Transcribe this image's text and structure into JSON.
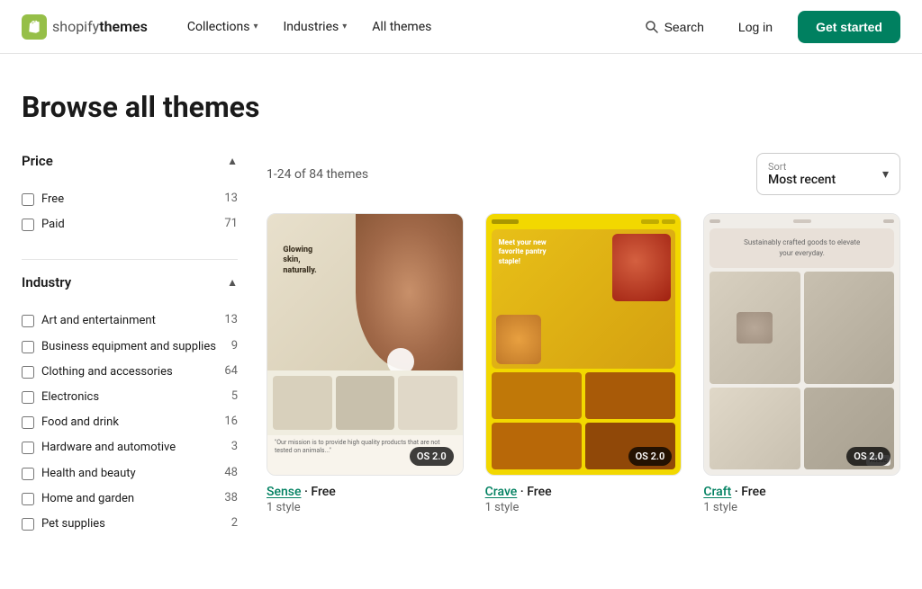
{
  "header": {
    "logo_text": "shopify",
    "logo_suffix": "themes",
    "nav": [
      {
        "label": "Collections",
        "has_dropdown": true
      },
      {
        "label": "Industries",
        "has_dropdown": true
      },
      {
        "label": "All themes",
        "has_dropdown": false
      }
    ],
    "search_label": "Search",
    "login_label": "Log in",
    "get_started_label": "Get started"
  },
  "page": {
    "title": "Browse all themes"
  },
  "filters": {
    "price": {
      "title": "Price",
      "options": [
        {
          "label": "Free",
          "count": "13"
        },
        {
          "label": "Paid",
          "count": "71"
        }
      ]
    },
    "industry": {
      "title": "Industry",
      "options": [
        {
          "label": "Art and entertainment",
          "count": "13"
        },
        {
          "label": "Business equipment and supplies",
          "count": "9"
        },
        {
          "label": "Clothing and accessories",
          "count": "64"
        },
        {
          "label": "Electronics",
          "count": "5"
        },
        {
          "label": "Food and drink",
          "count": "16"
        },
        {
          "label": "Hardware and automotive",
          "count": "3"
        },
        {
          "label": "Health and beauty",
          "count": "48"
        },
        {
          "label": "Home and garden",
          "count": "38"
        },
        {
          "label": "Pet supplies",
          "count": "2"
        }
      ]
    }
  },
  "content": {
    "themes_count": "1-24 of 84 themes",
    "sort": {
      "label": "Sort",
      "value": "Most recent"
    },
    "themes": [
      {
        "name": "Sense",
        "price": "Free",
        "styles": "1 style",
        "badge": "OS 2.0",
        "type": "sense"
      },
      {
        "name": "Crave",
        "price": "Free",
        "styles": "1 style",
        "badge": "OS 2.0",
        "type": "crave"
      },
      {
        "name": "Craft",
        "price": "Free",
        "styles": "1 style",
        "badge": "OS 2.0",
        "type": "craft"
      }
    ]
  }
}
